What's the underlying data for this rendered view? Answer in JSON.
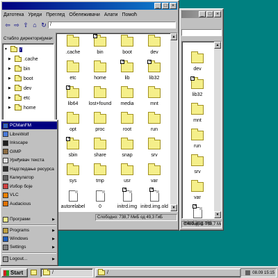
{
  "front_window": {
    "menu": [
      "Датотека",
      "Уреди",
      "Преглед",
      "Обележивачи",
      "Алати",
      "Помоћ"
    ],
    "toolbar_icons": [
      "back-arrow-icon",
      "forward-arrow-icon",
      "up-arrow-icon",
      "home-icon",
      "reload-icon"
    ],
    "address": "/",
    "tree_title": "Стабло директоријума",
    "tree": [
      {
        "label": "/",
        "selected": true
      },
      {
        "label": ".cache"
      },
      {
        "label": "bin"
      },
      {
        "label": "boot"
      },
      {
        "label": "dev"
      },
      {
        "label": "etc"
      },
      {
        "label": "home"
      }
    ],
    "items": [
      {
        "label": ".cache",
        "kind": "folder"
      },
      {
        "label": "bin",
        "kind": "folder",
        "link": true
      },
      {
        "label": "boot",
        "kind": "folder"
      },
      {
        "label": "dev",
        "kind": "folder"
      },
      {
        "label": "etc",
        "kind": "folder"
      },
      {
        "label": "home",
        "kind": "folder"
      },
      {
        "label": "lib",
        "kind": "folder",
        "link": true
      },
      {
        "label": "lib32",
        "kind": "folder",
        "link": true
      },
      {
        "label": "lib64",
        "kind": "folder",
        "link": true
      },
      {
        "label": "lost+found",
        "kind": "folder"
      },
      {
        "label": "media",
        "kind": "folder"
      },
      {
        "label": "mnt",
        "kind": "folder"
      },
      {
        "label": "opt",
        "kind": "folder"
      },
      {
        "label": "proc",
        "kind": "folder"
      },
      {
        "label": "root",
        "kind": "folder"
      },
      {
        "label": "run",
        "kind": "folder"
      },
      {
        "label": "sbin",
        "kind": "folder",
        "link": true
      },
      {
        "label": "share",
        "kind": "folder"
      },
      {
        "label": "snap",
        "kind": "folder"
      },
      {
        "label": "srv",
        "kind": "folder"
      },
      {
        "label": "sys",
        "kind": "folder"
      },
      {
        "label": "tmp",
        "kind": "folder"
      },
      {
        "label": "usr",
        "kind": "folder"
      },
      {
        "label": "var",
        "kind": "folder"
      },
      {
        "label": "autorelabel",
        "kind": "file"
      },
      {
        "label": "0",
        "kind": "file"
      },
      {
        "label": "initrd.img",
        "kind": "file",
        "link": true
      },
      {
        "label": "initrd.img.old",
        "kind": "file",
        "link": true
      }
    ],
    "status": "Слободно: 738,7 МиБ од 49,3 ГиБ"
  },
  "back_window": {
    "items": [
      {
        "label": "dev",
        "kind": "folder"
      },
      {
        "label": "lib32",
        "kind": "folder",
        "link": true
      },
      {
        "label": "mnt",
        "kind": "folder"
      },
      {
        "label": "run",
        "kind": "folder"
      },
      {
        "label": "srv",
        "kind": "folder"
      },
      {
        "label": "var",
        "kind": "folder"
      },
      {
        "label": "initrd.img.old",
        "kind": "file",
        "link": true
      }
    ],
    "status": "Слободно: 738,7 МиБ од 49,3 ГиБ"
  },
  "start_menu": {
    "apps": [
      {
        "label": "PCManFM",
        "icon": "pcmanfm-icon",
        "color": "#3060c0"
      },
      {
        "label": "LibreWolf",
        "icon": "librewolf-icon",
        "color": "#4a7ad8"
      },
      {
        "label": "Inkscape",
        "icon": "inkscape-icon",
        "color": "#202020"
      },
      {
        "label": "GIMP",
        "icon": "gimp-icon",
        "color": "#8a6a40"
      },
      {
        "label": "Уређивач текста",
        "icon": "text-editor-icon",
        "color": "#e0e0e0"
      },
      {
        "label": "Надгледање ресурса",
        "icon": "resource-monitor-icon",
        "color": "#303030"
      },
      {
        "label": "Калкулатор",
        "icon": "calculator-icon",
        "color": "#606060"
      },
      {
        "label": "Избор боје",
        "icon": "color-picker-icon",
        "color": "#d04040"
      },
      {
        "label": "VLC",
        "icon": "vlc-icon",
        "color": "#f08000"
      },
      {
        "label": "Audacious",
        "icon": "audacious-icon",
        "color": "#e07000"
      }
    ],
    "programs_local": "Програми",
    "programs": "Programs",
    "windows": "Windows",
    "settings": "Settings",
    "logout": "Logout..."
  },
  "taskbar": {
    "start": "Start",
    "task_label": "/",
    "clock": "08.09 15:15"
  },
  "colors": {
    "desktop": "#008080",
    "title_active": "#000080",
    "selection": "#000080",
    "folder": "#f5ef8a"
  }
}
